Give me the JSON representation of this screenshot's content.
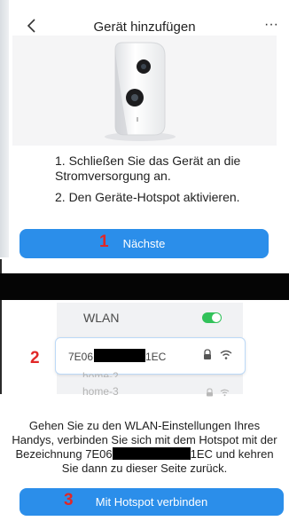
{
  "header": {
    "title": "Gerät hinzufügen",
    "more_label": "···"
  },
  "instructions": {
    "step1": "1. Schließen Sie das Gerät an die Stromversorgung an.",
    "step2": "2. Den Geräte-Hotspot aktivieren."
  },
  "buttons": {
    "next_label": "Nächste",
    "connect_label": "Mit Hotspot verbinden"
  },
  "annotations": {
    "badge1": "1",
    "badge2": "2",
    "badge3": "3",
    "color": "#e12727"
  },
  "wifi_panel": {
    "title": "WLAN",
    "toggle_on": true,
    "selected_network_prefix": "7E06",
    "selected_network_suffix": "1EC",
    "other_networks": [
      "home-2",
      "home-3"
    ]
  },
  "description": {
    "part1": "Gehen Sie zu den WLAN-Einstellungen Ihres Handys, verbinden Sie sich mit dem Hotspot mit der Bezeichnung 7E06",
    "part2": "1EC und kehren Sie dann zu dieser Seite zurück."
  },
  "colors": {
    "primary_button": "#2b8eea",
    "toggle_on": "#32c25a"
  }
}
